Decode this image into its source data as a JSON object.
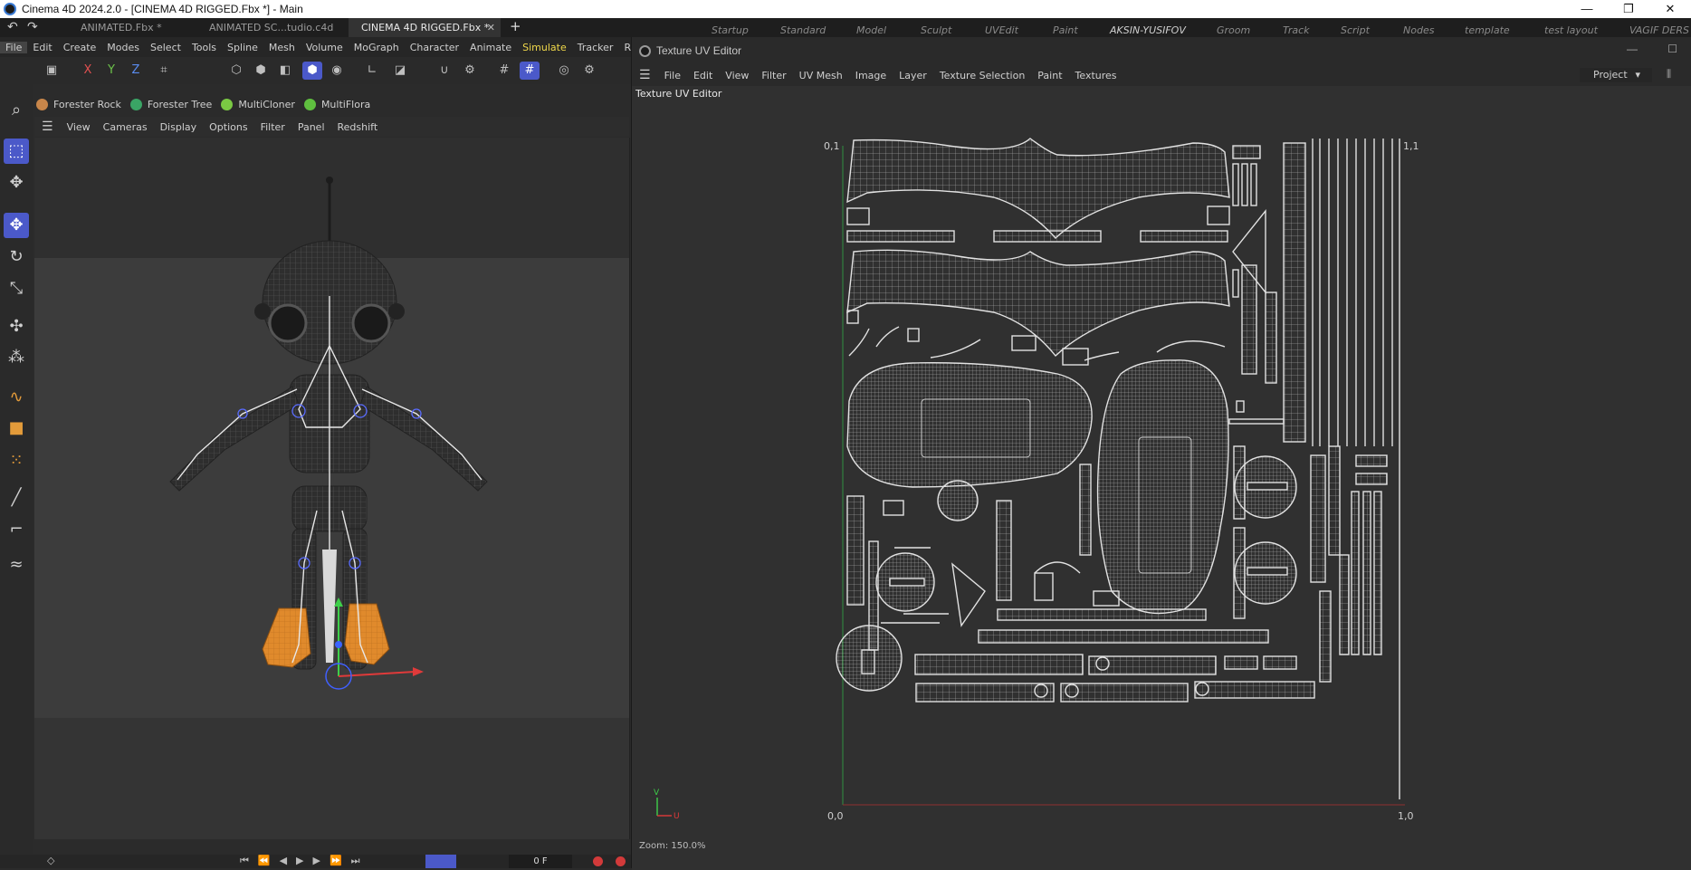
{
  "window": {
    "title": "Cinema 4D 2024.2.0 - [CINEMA 4D RIGGED.Fbx *] - Main",
    "controls": [
      "—",
      "❐",
      "✕"
    ]
  },
  "tabs": [
    {
      "label": "ANIMATED.Fbx *",
      "active": false
    },
    {
      "label": "ANIMATED SC...tudio.c4d *",
      "active": false
    },
    {
      "label": "CINEMA 4D RIGGED.Fbx *",
      "active": true
    }
  ],
  "tab_close": "✕",
  "tab_add": "+",
  "layouts": [
    "Startup",
    "Standard",
    "Model",
    "Sculpt",
    "UVEdit",
    "Paint",
    "AKSIN-YUSIFOV",
    "Groom",
    "Track",
    "Script",
    "Nodes",
    "template",
    "test layout",
    "VAGIF DERS"
  ],
  "main_menu": [
    "File",
    "Edit",
    "Create",
    "Modes",
    "Select",
    "Tools",
    "Spline",
    "Mesh",
    "Volume",
    "MoGraph",
    "Character",
    "Animate",
    "Simulate",
    "Tracker",
    "Rende"
  ],
  "axis_buttons": [
    "X",
    "Y",
    "Z"
  ],
  "plugins": [
    {
      "label": "Forester Rock",
      "color": "#c8864a"
    },
    {
      "label": "Forester Tree",
      "color": "#3aa565"
    },
    {
      "label": "MultiCloner",
      "color": "#7ac943"
    },
    {
      "label": "MultiFlora",
      "color": "#5fbf3f"
    }
  ],
  "viewport_menu": [
    "View",
    "Cameras",
    "Display",
    "Options",
    "Filter",
    "Panel",
    "Redshift"
  ],
  "uv_editor": {
    "window_title": "Texture UV Editor",
    "panel_label": "Texture UV Editor",
    "menu": [
      "File",
      "Edit",
      "View",
      "Filter",
      "UV Mesh",
      "Image",
      "Layer",
      "Texture Selection",
      "Paint",
      "Textures"
    ],
    "project_select": "Project",
    "axis_labels": {
      "top_left": "0,1",
      "top_right": "1,1",
      "bottom_left": "0,0",
      "bottom_right": "1,0"
    },
    "gizmo": {
      "v": "V",
      "u": "U"
    },
    "zoom": "Zoom: 150.0%"
  },
  "timeline": {
    "frame": "0 F"
  },
  "colors": {
    "accent": "#4b59c9",
    "simulate": "#f0d84a",
    "feet": "#e08a2c",
    "uv_lines": "#d9d9d9"
  }
}
